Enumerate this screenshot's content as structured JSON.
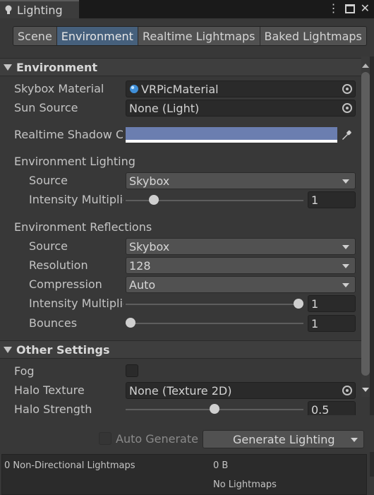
{
  "window": {
    "title": "Lighting",
    "menu_glyph": "⋮",
    "close_glyph": "✕"
  },
  "tabs": [
    {
      "label": "Scene",
      "active": false
    },
    {
      "label": "Environment",
      "active": true
    },
    {
      "label": "Realtime Lightmaps",
      "active": false
    },
    {
      "label": "Baked Lightmaps",
      "active": false
    }
  ],
  "environment": {
    "header": "Environment",
    "skybox_material": {
      "label": "Skybox Material",
      "value": "VRPicMaterial"
    },
    "sun_source": {
      "label": "Sun Source",
      "value": "None (Light)"
    },
    "realtime_shadow_color": {
      "label": "Realtime Shadow C",
      "color": "#6b7eb0"
    },
    "lighting": {
      "header": "Environment Lighting",
      "source": {
        "label": "Source",
        "value": "Skybox"
      },
      "intensity": {
        "label": "Intensity Multiplie",
        "value": "1",
        "fraction": 0.14
      }
    },
    "reflections": {
      "header": "Environment Reflections",
      "source": {
        "label": "Source",
        "value": "Skybox"
      },
      "resolution": {
        "label": "Resolution",
        "value": "128"
      },
      "compression": {
        "label": "Compression",
        "value": "Auto"
      },
      "intensity": {
        "label": "Intensity Multiplie",
        "value": "1",
        "fraction": 1.0
      },
      "bounces": {
        "label": "Bounces",
        "value": "1",
        "fraction": 0.0
      }
    }
  },
  "other_settings": {
    "header": "Other Settings",
    "fog": {
      "label": "Fog",
      "checked": false
    },
    "halo_texture": {
      "label": "Halo Texture",
      "value": "None (Texture 2D)"
    },
    "halo_strength": {
      "label": "Halo Strength",
      "value": "0.5",
      "fraction": 0.5
    }
  },
  "footer": {
    "auto_generate": {
      "label": "Auto Generate",
      "checked": false
    },
    "generate_button": "Generate Lighting",
    "stats": {
      "lightmaps": "0 Non-Directional Lightmaps",
      "size": "0 B",
      "status": "No Lightmaps"
    }
  },
  "colors": {
    "active_tab": "#46607c",
    "panel": "#383838",
    "shadow_color": "#6b7eb0"
  }
}
